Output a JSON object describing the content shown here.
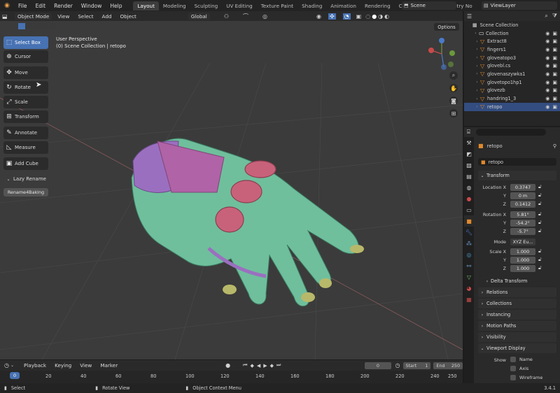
{
  "menu": [
    "File",
    "Edit",
    "Render",
    "Window",
    "Help"
  ],
  "workspaces": [
    "Layout",
    "Modeling",
    "Sculpting",
    "UV Editing",
    "Texture Paint",
    "Shading",
    "Animation",
    "Rendering",
    "Compositing",
    "Geometry No"
  ],
  "scene": {
    "name": "Scene",
    "view_layer": "ViewLayer"
  },
  "viewport_header": {
    "mode": "Object Mode",
    "menus": [
      "View",
      "Select",
      "Add",
      "Object"
    ],
    "transform_orientation": "Global"
  },
  "options_label": "Options",
  "overlay": {
    "perspective": "User Perspective",
    "collection_path": "(0) Scene Collection | retopo"
  },
  "tools": [
    {
      "label": "Select Box",
      "icon": "select-box-icon",
      "glyph": "⬚"
    },
    {
      "label": "Cursor",
      "icon": "cursor-icon",
      "glyph": "⊕"
    },
    {
      "label": "Move",
      "icon": "move-icon",
      "glyph": "✥"
    },
    {
      "label": "Rotate",
      "icon": "rotate-icon",
      "glyph": "↻"
    },
    {
      "label": "Scale",
      "icon": "scale-icon",
      "glyph": "⤢"
    },
    {
      "label": "Transform",
      "icon": "transform-icon",
      "glyph": "⊞"
    },
    {
      "label": "Annotate",
      "icon": "annotate-icon",
      "glyph": "✎"
    },
    {
      "label": "Measure",
      "icon": "measure-icon",
      "glyph": "◺"
    },
    {
      "label": "Add Cube",
      "icon": "add-cube-icon",
      "glyph": "▣"
    }
  ],
  "lazy_rename": {
    "title": "Lazy Rename",
    "button": "Rename4Baking"
  },
  "outliner": {
    "root": "Scene Collection",
    "items": [
      {
        "name": "Collection",
        "type": "collection"
      },
      {
        "name": "Extract8",
        "type": "mesh"
      },
      {
        "name": "fingers1",
        "type": "mesh"
      },
      {
        "name": "gloveatopo3",
        "type": "mesh"
      },
      {
        "name": "glovebl.cs",
        "type": "mesh"
      },
      {
        "name": "glovenaszywka1",
        "type": "mesh"
      },
      {
        "name": "glovetopo1hp1",
        "type": "mesh"
      },
      {
        "name": "glovezb",
        "type": "mesh"
      },
      {
        "name": "handring1_3",
        "type": "mesh"
      },
      {
        "name": "retopo",
        "type": "mesh",
        "selected": true
      }
    ]
  },
  "properties": {
    "object_name": "retopo",
    "datablock": "retopo",
    "transform_title": "Transform",
    "location": {
      "label": "Location X",
      "x": "0.3747",
      "y": "0 m",
      "z": "0.1412"
    },
    "rotation": {
      "label": "Rotation X",
      "x": "5.81°",
      "y": "-54.2°",
      "z": "-5.7°"
    },
    "mode": {
      "label": "Mode",
      "value": "XYZ Eu..."
    },
    "scale": {
      "label": "Scale X",
      "x": "1.000",
      "y": "1.000",
      "z": "1.000"
    },
    "axis_labels": {
      "y": "Y",
      "z": "Z"
    },
    "panels": [
      "Delta Transform",
      "Relations",
      "Collections",
      "Instancing",
      "Motion Paths",
      "Visibility",
      "Viewport Display"
    ],
    "viewport_display": {
      "show": "Show",
      "options": [
        "Name",
        "Axis",
        "Wireframe"
      ]
    }
  },
  "timeline": {
    "menus": [
      "Playback",
      "Keying",
      "View",
      "Marker"
    ],
    "current_frame": "0",
    "start_label": "Start",
    "start": "1",
    "end_label": "End",
    "end": "250",
    "ticks": [
      "0",
      "20",
      "40",
      "60",
      "80",
      "100",
      "120",
      "140",
      "160",
      "180",
      "200",
      "220",
      "240",
      "250"
    ]
  },
  "statusbar": {
    "select": "Select",
    "rotate": "Rotate View",
    "context": "Object Context Menu",
    "version": "3.4.1"
  },
  "colors": {
    "accent": "#4772b3",
    "selected_row": "#334d80",
    "glove_body": "#6fbf9c",
    "glove_purple": "#9b6fc0",
    "glove_pink": "#c8627a",
    "glove_tip": "#b8b86a",
    "playhead": "#4772b3"
  }
}
